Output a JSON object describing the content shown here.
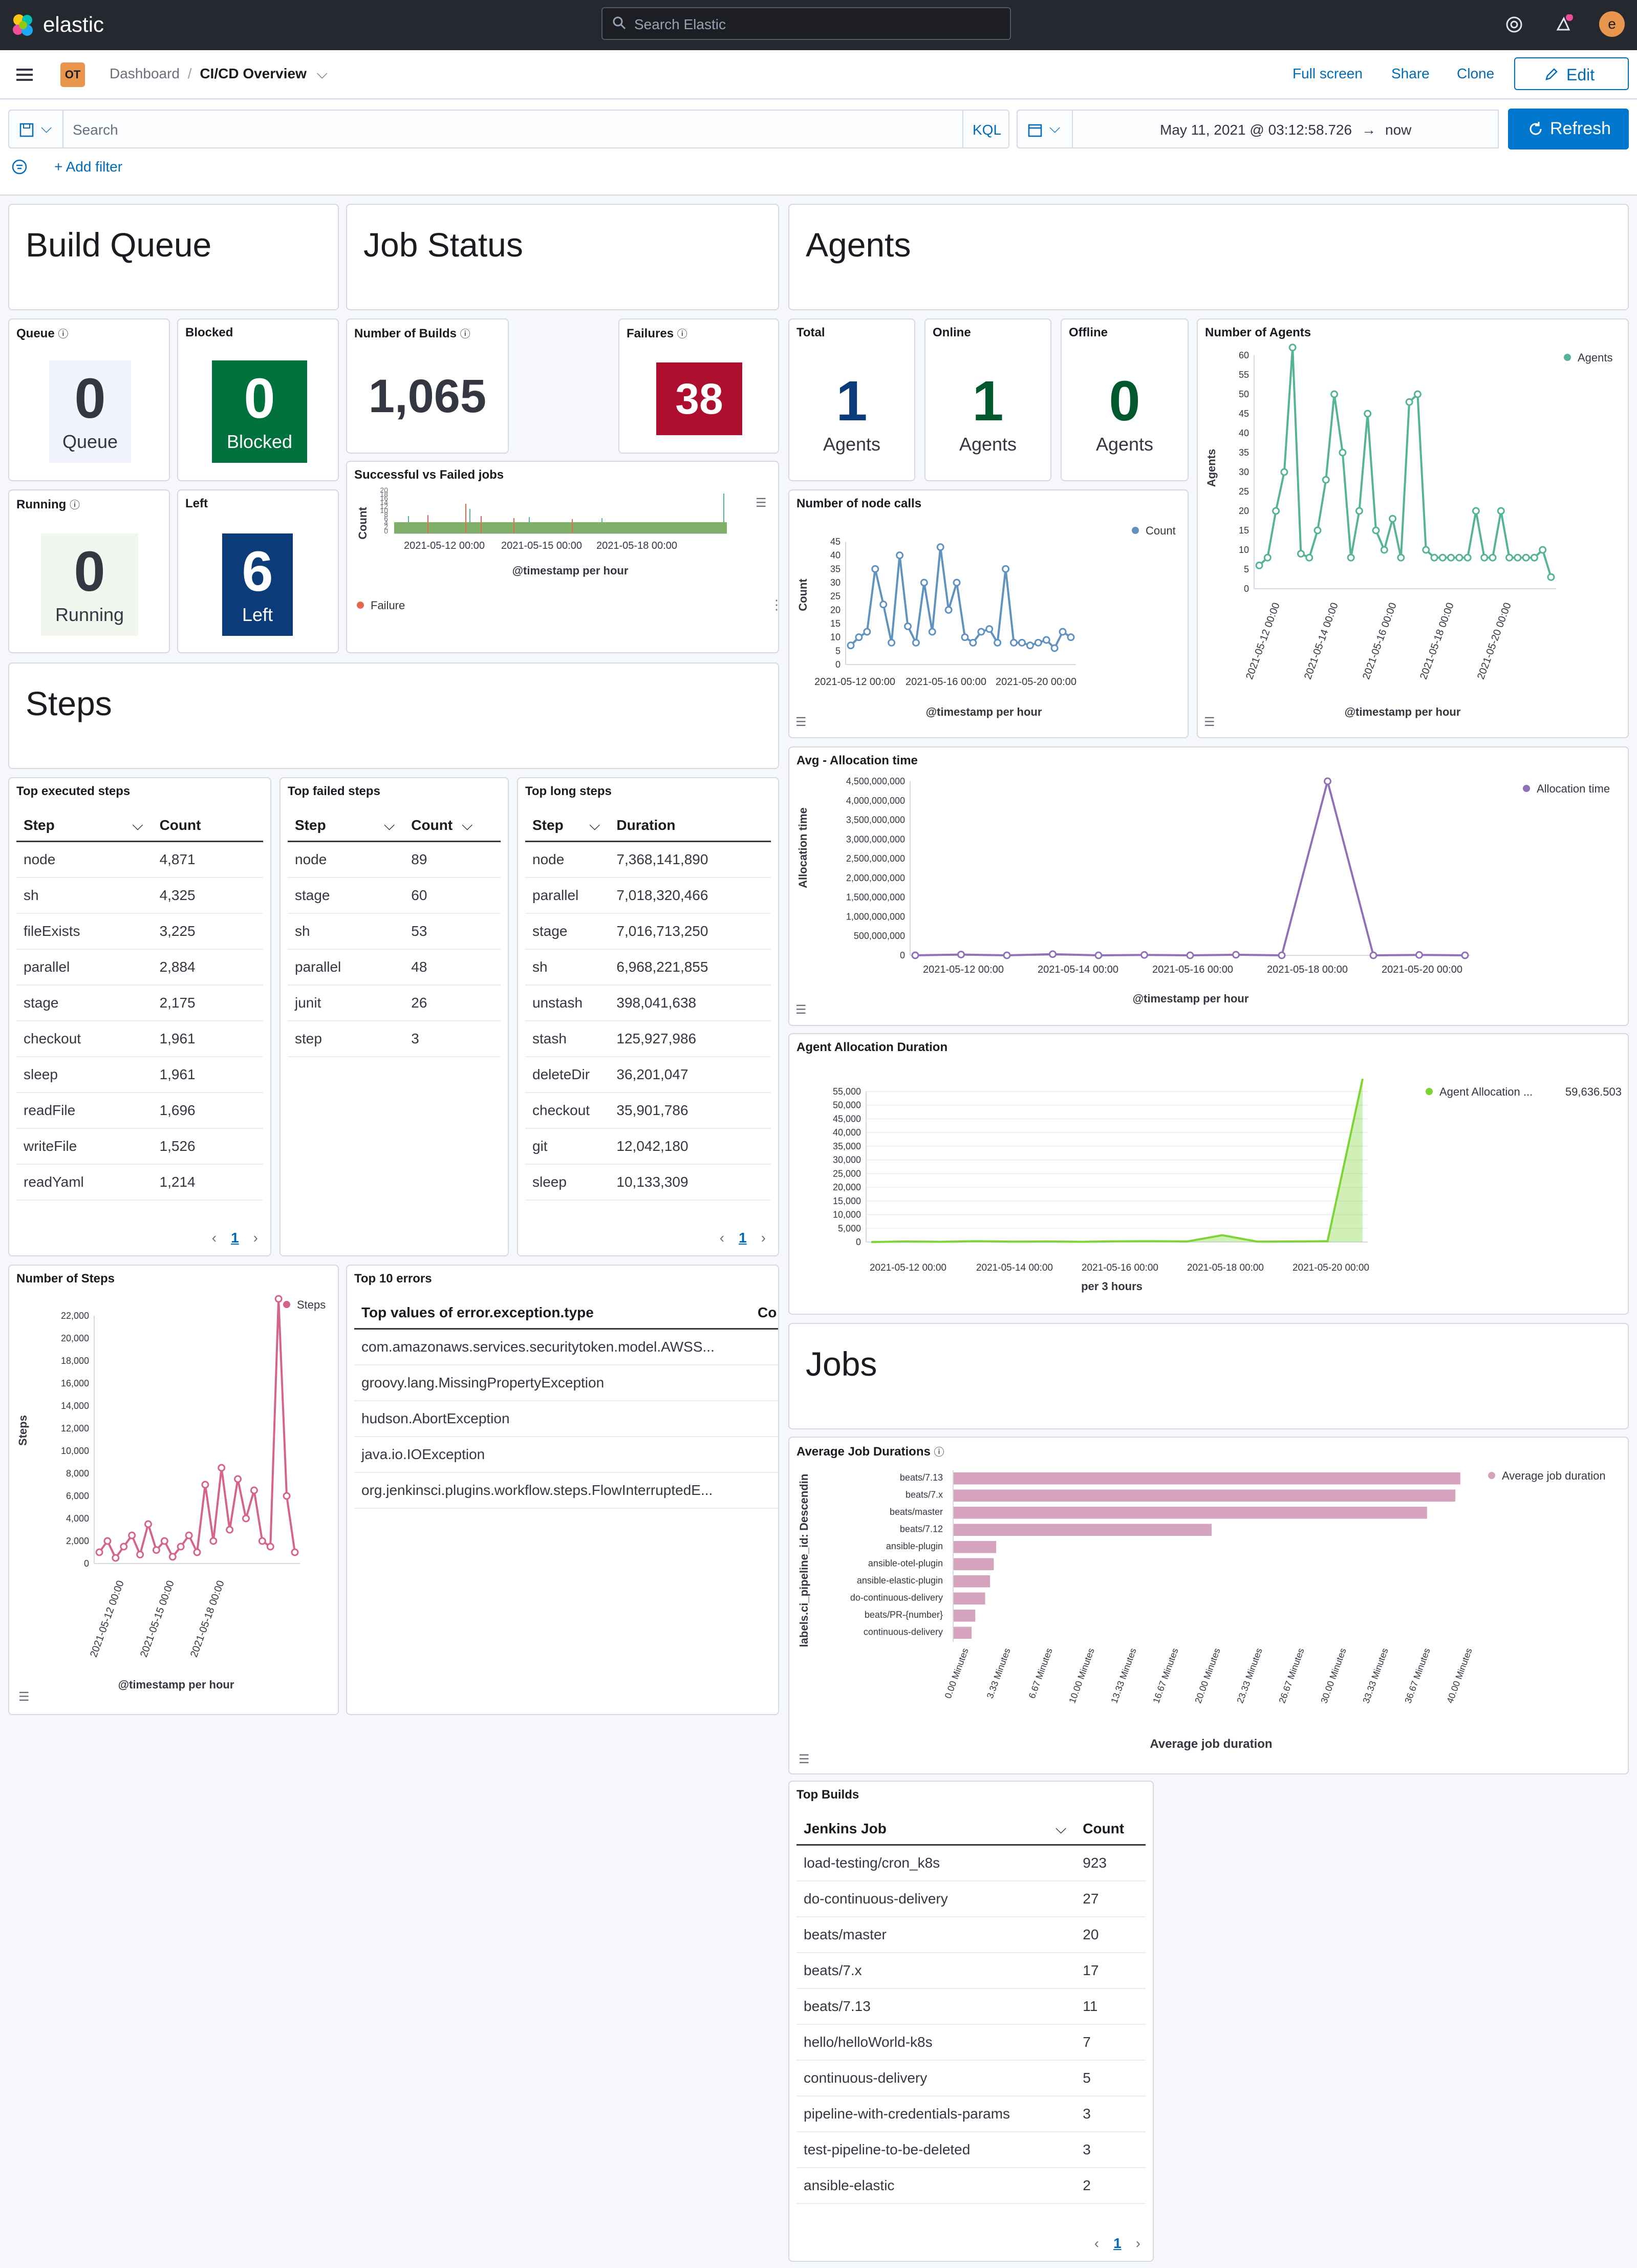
{
  "topbar": {
    "brand": "elastic",
    "search_placeholder": "Search Elastic",
    "user_initial": "e"
  },
  "breadcrumb": {
    "space_badge": "OT",
    "parent": "Dashboard",
    "current": "CI/CD Overview",
    "full_screen": "Full screen",
    "share": "Share",
    "clone": "Clone",
    "edit": "Edit"
  },
  "query_bar": {
    "search_placeholder": "Search",
    "kql": "KQL",
    "time_start": "May 11, 2021 @ 03:12:58.726",
    "time_arrow": "→",
    "time_end": "now",
    "refresh": "Refresh",
    "add_filter": "+ Add filter"
  },
  "sections": {
    "build_queue": "Build Queue",
    "job_status": "Job Status",
    "agents": "Agents",
    "steps": "Steps",
    "jobs": "Jobs"
  },
  "metrics": {
    "queue": {
      "title": "Queue",
      "value": "0",
      "label": "Queue",
      "bg": "#f1f4fa",
      "fg": "#343741"
    },
    "blocked": {
      "title": "Blocked",
      "value": "0",
      "label": "Blocked",
      "bg": "#00703c",
      "fg": "#ffffff"
    },
    "running": {
      "title": "Running",
      "value": "0",
      "label": "Running",
      "bg": "#f1f7ef",
      "fg": "#343741"
    },
    "left": {
      "title": "Left",
      "value": "6",
      "label": "Left",
      "bg": "#0b3b79",
      "fg": "#ffffff"
    },
    "builds": {
      "title": "Number of Builds",
      "value": "1,065"
    },
    "failures": {
      "title": "Failures",
      "value": "38",
      "bg": "#ae0f2e",
      "fg": "#ffffff"
    },
    "total": {
      "title": "Total",
      "value": "1",
      "label": "Agents",
      "fg": "#0b3b79"
    },
    "online": {
      "title": "Online",
      "value": "1",
      "label": "Agents",
      "fg": "#00582d"
    },
    "offline": {
      "title": "Offline",
      "value": "0",
      "label": "Agents",
      "fg": "#00582d"
    }
  },
  "charts": {
    "succ_failed": {
      "title": "Successful vs Failed jobs",
      "ylabel": "Count",
      "xlabel": "@timestamp per hour",
      "legend": "Failure",
      "ticks": [
        "2021-05-12 00:00",
        "2021-05-15 00:00",
        "2021-05-18 00:00"
      ],
      "yticks": [
        "20",
        "18",
        "16",
        "14",
        "12",
        "10",
        "8",
        "6",
        "4",
        "2",
        "0"
      ]
    },
    "node_calls": {
      "title": "Number of node calls",
      "ylabel": "Count",
      "xlabel": "@timestamp per hour",
      "legend": "Count",
      "ticks": [
        "2021-05-12 00:00",
        "2021-05-16 00:00",
        "2021-05-20 00:00"
      ]
    },
    "agents": {
      "title": "Number of Agents",
      "ylabel": "Agents",
      "xlabel": "@timestamp per hour",
      "legend": "Agents",
      "ticks": [
        "2021-05-12 00:00",
        "2021-05-14 00:00",
        "2021-05-16 00:00",
        "2021-05-18 00:00",
        "2021-05-20 00:00"
      ]
    },
    "alloc_time": {
      "title": "Avg - Allocation time",
      "ylabel": "Allocation time",
      "xlabel": "@timestamp per hour",
      "legend": "Allocation time",
      "ticks": [
        "2021-05-12 00:00",
        "2021-05-14 00:00",
        "2021-05-16 00:00",
        "2021-05-18 00:00",
        "2021-05-20 00:00"
      ]
    },
    "alloc_dur": {
      "title": "Agent Allocation Duration",
      "xlabel": "per 3 hours",
      "legend": "Agent Allocation ...",
      "legend_value": "59,636.503",
      "ticks": [
        "2021-05-12 00:00",
        "2021-05-14 00:00",
        "2021-05-16 00:00",
        "2021-05-18 00:00",
        "2021-05-20 00:00"
      ]
    },
    "steps": {
      "title": "Number of Steps",
      "ylabel": "Steps",
      "xlabel": "@timestamp per hour",
      "legend": "Steps",
      "ticks": [
        "2021-05-12 00:00",
        "2021-05-15 00:00",
        "2021-05-18 00:00"
      ]
    },
    "job_dur": {
      "title": "Average Job Durations",
      "ylabel": "labels.ci_pipeline_id: Descendin",
      "xlabel": "Average job duration",
      "legend": "Average job duration"
    }
  },
  "chart_data": [
    {
      "type": "line",
      "title": "Number of node calls",
      "ylabel": "Count",
      "xlabel": "@timestamp per hour",
      "ylim": [
        0,
        45
      ],
      "yticks": [
        0,
        5,
        10,
        15,
        20,
        25,
        30,
        35,
        40,
        45
      ],
      "series": [
        {
          "name": "Count",
          "values": [
            7,
            10,
            12,
            35,
            22,
            8,
            40,
            14,
            8,
            30,
            12,
            43,
            20,
            30,
            10,
            8,
            12,
            13,
            8,
            35,
            8,
            8,
            7,
            8,
            9,
            6,
            12,
            10
          ]
        }
      ]
    },
    {
      "type": "line",
      "title": "Number of Agents",
      "ylabel": "Agents",
      "xlabel": "@timestamp per hour",
      "ylim": [
        0,
        60
      ],
      "yticks": [
        0,
        5,
        10,
        15,
        20,
        25,
        30,
        35,
        40,
        45,
        50,
        55,
        60
      ],
      "series": [
        {
          "name": "Agents",
          "values": [
            6,
            8,
            20,
            30,
            62,
            9,
            8,
            15,
            28,
            50,
            35,
            8,
            20,
            45,
            15,
            10,
            18,
            8,
            48,
            50,
            10,
            8,
            8,
            8,
            8,
            8,
            20,
            8,
            8,
            20,
            8,
            8,
            8,
            8,
            10,
            3
          ]
        }
      ]
    },
    {
      "type": "line",
      "title": "Avg - Allocation time",
      "ylabel": "Allocation time",
      "xlabel": "@timestamp per hour",
      "ylim": [
        0,
        4500000000
      ],
      "yticks": [
        0,
        500000000,
        1000000000,
        1500000000,
        2000000000,
        2500000000,
        3000000000,
        3500000000,
        4000000000,
        4500000000
      ],
      "series": [
        {
          "name": "Allocation time",
          "values": [
            0,
            20000000,
            0,
            30000000,
            0,
            10000000,
            0,
            15000000,
            0,
            4500000000,
            0,
            10000000,
            0
          ]
        }
      ]
    },
    {
      "type": "area",
      "title": "Agent Allocation Duration",
      "xlabel": "per 3 hours",
      "ylim": [
        0,
        55000
      ],
      "yticks": [
        0,
        5000,
        10000,
        15000,
        20000,
        25000,
        30000,
        35000,
        40000,
        45000,
        50000,
        55000
      ],
      "series": [
        {
          "name": "Agent Allocation ...",
          "values": [
            0,
            200,
            100,
            300,
            150,
            200,
            100,
            250,
            300,
            200,
            2500,
            150,
            200,
            300,
            59636.503
          ]
        }
      ]
    },
    {
      "type": "line",
      "title": "Number of Steps",
      "ylabel": "Steps",
      "xlabel": "@timestamp per hour",
      "ylim": [
        0,
        22000
      ],
      "yticks": [
        0,
        2000,
        4000,
        6000,
        8000,
        10000,
        12000,
        14000,
        16000,
        18000,
        20000,
        22000
      ],
      "series": [
        {
          "name": "Steps",
          "values": [
            1000,
            2000,
            500,
            1500,
            2500,
            800,
            3500,
            1200,
            2000,
            600,
            1500,
            2500,
            1000,
            7000,
            2000,
            8500,
            3000,
            7500,
            4000,
            6500,
            2000,
            1500,
            23500,
            6000,
            1000
          ]
        }
      ]
    },
    {
      "type": "bar",
      "title": "Average Job Durations",
      "ylabel": "labels.ci_pipeline_id: Descendin",
      "xlabel": "Average job duration",
      "categories": [
        "beats/7.13",
        "beats/7.x",
        "beats/master",
        "beats/7.12",
        "ansible-plugin",
        "ansible-otel-plugin",
        "ansible-elastic-plugin",
        "do-continuous-delivery",
        "beats/PR-{number}",
        "continuous-delivery"
      ],
      "series": [
        {
          "name": "Average job duration",
          "values": [
            41.2,
            40.8,
            38.5,
            21.0,
            3.5,
            3.3,
            3.0,
            2.6,
            1.8,
            1.5
          ]
        }
      ],
      "xticks": [
        "0.00 Minutes",
        "3.33 Minutes",
        "6.67 Minutes",
        "10.00 Minutes",
        "13.33 Minutes",
        "16.67 Minutes",
        "20.00 Minutes",
        "23.33 Minutes",
        "26.67 Minutes",
        "30.00 Minutes",
        "33.33 Minutes",
        "36.67 Minutes",
        "40.00 Minutes"
      ]
    }
  ],
  "tables": {
    "executed": {
      "title": "Top executed steps",
      "h1": "Step",
      "h2": "Count",
      "rows": [
        [
          "node",
          "4,871"
        ],
        [
          "sh",
          "4,325"
        ],
        [
          "fileExists",
          "3,225"
        ],
        [
          "parallel",
          "2,884"
        ],
        [
          "stage",
          "2,175"
        ],
        [
          "checkout",
          "1,961"
        ],
        [
          "sleep",
          "1,961"
        ],
        [
          "readFile",
          "1,696"
        ],
        [
          "writeFile",
          "1,526"
        ],
        [
          "readYaml",
          "1,214"
        ]
      ],
      "page": "1"
    },
    "failed": {
      "title": "Top failed steps",
      "h1": "Step",
      "h2": "Count",
      "rows": [
        [
          "node",
          "89"
        ],
        [
          "stage",
          "60"
        ],
        [
          "sh",
          "53"
        ],
        [
          "parallel",
          "48"
        ],
        [
          "junit",
          "26"
        ],
        [
          "step",
          "3"
        ]
      ]
    },
    "long": {
      "title": "Top long steps",
      "h1": "Step",
      "h2": "Duration",
      "rows": [
        [
          "node",
          "7,368,141,890"
        ],
        [
          "parallel",
          "7,018,320,466"
        ],
        [
          "stage",
          "7,016,713,250"
        ],
        [
          "sh",
          "6,968,221,855"
        ],
        [
          "unstash",
          "398,041,638"
        ],
        [
          "stash",
          "125,927,986"
        ],
        [
          "deleteDir",
          "36,201,047"
        ],
        [
          "checkout",
          "35,901,786"
        ],
        [
          "git",
          "12,042,180"
        ],
        [
          "sleep",
          "10,133,309"
        ]
      ],
      "page": "1"
    },
    "errors": {
      "title": "Top 10 errors",
      "h1": "Top values of error.exception.type",
      "h2": "Co",
      "rows": [
        "com.amazonaws.services.securitytoken.model.AWSS...",
        "groovy.lang.MissingPropertyException",
        "hudson.AbortException",
        "java.io.IOException",
        "org.jenkinsci.plugins.workflow.steps.FlowInterruptedE..."
      ]
    },
    "builds": {
      "title": "Top Builds",
      "h1": "Jenkins Job",
      "h2": "Count",
      "rows": [
        [
          "load-testing/cron_k8s",
          "923"
        ],
        [
          "do-continuous-delivery",
          "27"
        ],
        [
          "beats/master",
          "20"
        ],
        [
          "beats/7.x",
          "17"
        ],
        [
          "beats/7.13",
          "11"
        ],
        [
          "hello/helloWorld-k8s",
          "7"
        ],
        [
          "continuous-delivery",
          "5"
        ],
        [
          "pipeline-with-credentials-params",
          "3"
        ],
        [
          "test-pipeline-to-be-deleted",
          "3"
        ],
        [
          "ansible-elastic",
          "2"
        ]
      ],
      "page": "1"
    }
  }
}
